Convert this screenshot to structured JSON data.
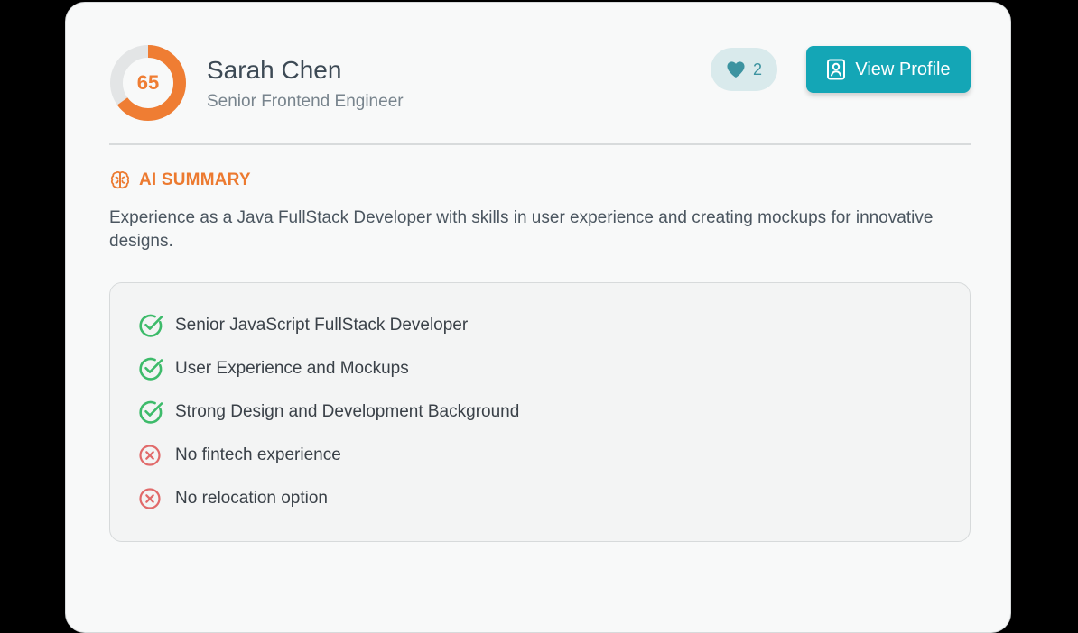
{
  "candidate": {
    "score": "65",
    "score_fraction": 0.65,
    "name": "Sarah Chen",
    "role": "Senior Frontend Engineer"
  },
  "actions": {
    "like_count": "2",
    "view_profile_label": "View Profile"
  },
  "ai_summary": {
    "title": "AI SUMMARY",
    "text": "Experience as a Java FullStack Developer with skills in user experience and creating mockups for innovative designs."
  },
  "highlights": [
    {
      "label": "Senior JavaScript FullStack Developer",
      "status": "positive",
      "icon": "check-circle-icon"
    },
    {
      "label": "User Experience and Mockups",
      "status": "positive",
      "icon": "check-circle-icon"
    },
    {
      "label": "Strong Design and Development Background",
      "status": "positive",
      "icon": "check-circle-icon"
    },
    {
      "label": "No fintech experience",
      "status": "negative",
      "icon": "x-circle-icon"
    },
    {
      "label": "No relocation option",
      "status": "negative",
      "icon": "x-circle-icon"
    }
  ],
  "colors": {
    "accent": "#14a6b6",
    "score": "#ef7d33",
    "positive": "#3dbb6a",
    "negative": "#e16a6a"
  }
}
